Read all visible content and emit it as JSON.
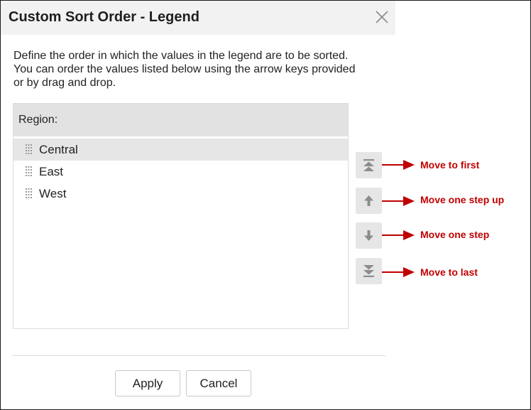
{
  "dialog": {
    "title": "Custom Sort Order - Legend",
    "description_lines": [
      "Define the order in which the values in the legend are to be sorted.",
      "You can order the values listed below using the arrow keys provided",
      "or by drag and drop."
    ],
    "list_header": "Region:",
    "items": [
      {
        "label": "Central",
        "selected": true
      },
      {
        "label": "East",
        "selected": false
      },
      {
        "label": "West",
        "selected": false
      }
    ],
    "buttons": {
      "apply": "Apply",
      "cancel": "Cancel"
    }
  },
  "annotations": {
    "move_first": "Move to first",
    "move_up": "Move one step up",
    "move_down": "Move one step",
    "move_last": "Move to last"
  },
  "colors": {
    "annotation": "#c00000",
    "title_bar": "#f2f2f2",
    "selected_row": "#e6e6e6"
  },
  "icons": [
    "close-icon",
    "drag-handle-icon",
    "move-first-icon",
    "move-up-icon",
    "move-down-icon",
    "move-last-icon",
    "annotation-arrow-icon"
  ]
}
